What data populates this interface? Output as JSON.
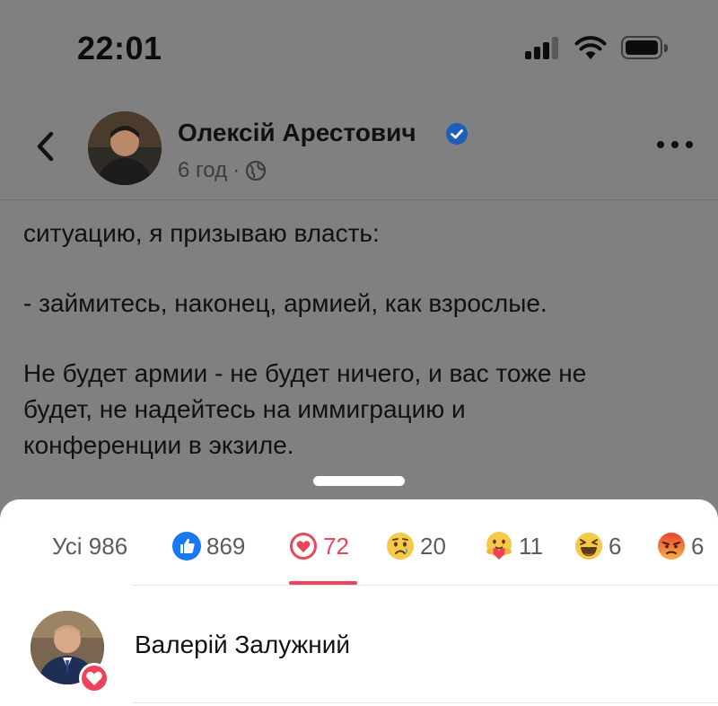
{
  "status_bar": {
    "time": "22:01",
    "icons": [
      "cellular-signal-icon",
      "wifi-icon",
      "battery-icon"
    ]
  },
  "post": {
    "author": "Олексій Арестович",
    "verified": true,
    "time_ago": "6 год",
    "audience_icon": "globe-icon",
    "text_lines": [
      "ситуацию, я призываю власть:",
      "",
      "- займитесь, наконец, армией, как взрослые.",
      "",
      "Не будет армии - не будет ничего, и вас тоже не",
      "будет, не надейтесь на иммиграцию и",
      "конференции в экзиле."
    ]
  },
  "reactions_sheet": {
    "tabs": [
      {
        "label": "Усі 986",
        "icon": "",
        "active": false
      },
      {
        "label": "869",
        "icon": "like-icon",
        "active": false
      },
      {
        "label": "72",
        "icon": "love-icon",
        "active": true
      },
      {
        "label": "20",
        "icon": "sad-icon",
        "active": false
      },
      {
        "label": "11",
        "icon": "care-icon",
        "active": false
      },
      {
        "label": "6",
        "icon": "haha-icon",
        "active": false
      },
      {
        "label": "6",
        "icon": "angry-icon",
        "active": false
      }
    ],
    "reactors": [
      {
        "name": "Валерій Залужний",
        "reaction": "love-icon"
      }
    ]
  },
  "colors": {
    "accent_love": "#e8465a",
    "like_blue": "#1877f2",
    "verified_blue": "#1877f2",
    "overlay": "#808080"
  }
}
